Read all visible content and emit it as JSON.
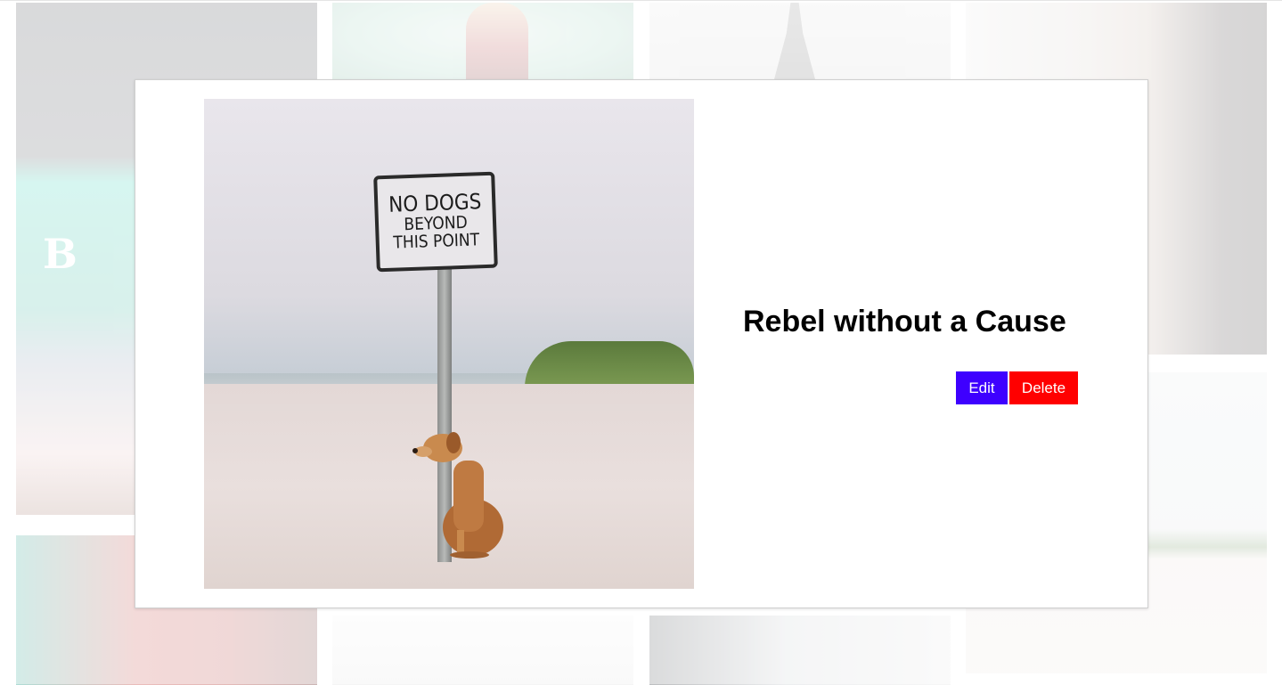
{
  "modal": {
    "title": "Rebel without a Cause",
    "image_alt": "Dog sitting next to a sign on a beach",
    "sign_text": {
      "line1": "NO DOGS",
      "line2": "BEYOND",
      "line3": "THIS POINT"
    },
    "edit_label": "Edit",
    "delete_label": "Delete"
  },
  "background_tiles": {
    "stage_text": "B"
  },
  "colors": {
    "edit_button": "#3e00ff",
    "delete_button": "#ff0000",
    "modal_background": "#ffffff",
    "title_text": "#000000"
  }
}
